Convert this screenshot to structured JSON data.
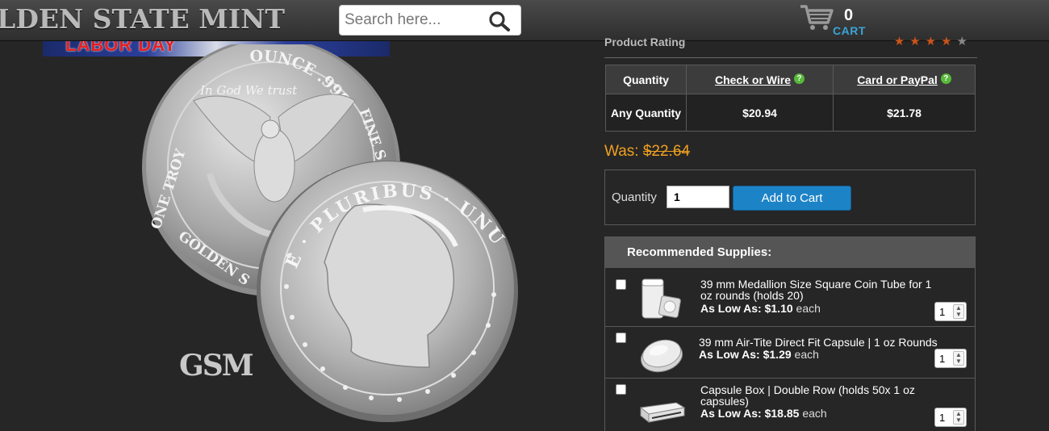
{
  "header": {
    "logo": "LDEN STATE MINT",
    "search_placeholder": "Search here...",
    "cart_count": "0",
    "cart_label": "CART"
  },
  "product": {
    "banner_text": "LABOR DAY",
    "coin_reverse_top": "OUNCE .999",
    "coin_reverse_motto": "In God We trust",
    "coin_reverse_left": "ONE TROY",
    "coin_reverse_right": "FINE S",
    "coin_reverse_bottom": "GOLDEN S",
    "coin_obverse_text": "E · PLURIBUS · UNUM",
    "watermark": "GSM"
  },
  "rating": {
    "label": "Product Rating",
    "stars": 4,
    "max_stars": 5,
    "on_color": "#c9541b",
    "off_color": "#888888"
  },
  "price_table": {
    "headers": [
      "Quantity",
      "Check or Wire",
      "Card or PayPal"
    ],
    "help_glyph": "?",
    "rows": [
      {
        "qty": "Any Quantity",
        "check": "$20.94",
        "card": "$21.78"
      }
    ]
  },
  "was": {
    "label": "Was:",
    "price": "$22.64"
  },
  "order": {
    "qty_label": "Quantity",
    "qty_value": "1",
    "add_button": "Add to Cart"
  },
  "supplies": {
    "heading": "Recommended Supplies:",
    "items": [
      {
        "title": "39 mm Medallion Size Square Coin Tube for 1 oz rounds (holds 20)",
        "low_label": "As Low As:",
        "price": "$1.10",
        "unit": "each",
        "qty": "1",
        "icon": "coin-tube-icon"
      },
      {
        "title": "39 mm Air-Tite Direct Fit Capsule | 1 oz Rounds",
        "low_label": "As Low As:",
        "price": "$1.29",
        "unit": "each",
        "qty": "1",
        "icon": "capsule-icon"
      },
      {
        "title": "Capsule Box | Double Row (holds 50x 1 oz capsules)",
        "low_label": "As Low As:",
        "price": "$18.85",
        "unit": "each",
        "qty": "1",
        "icon": "capsule-box-icon"
      }
    ]
  }
}
